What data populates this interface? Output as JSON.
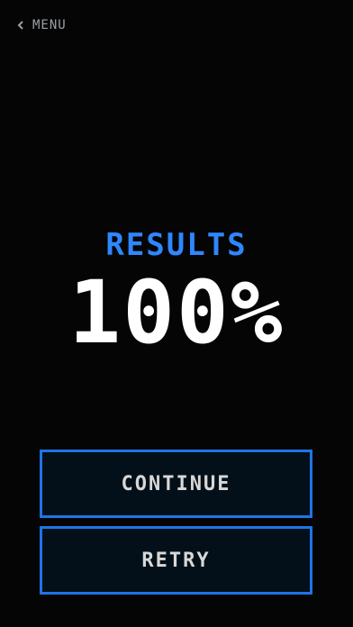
{
  "nav": {
    "back_label": "MENU",
    "back_icon": "chevron-left-icon"
  },
  "results": {
    "title": "RESULTS",
    "score": "100%",
    "score_value": 100
  },
  "buttons": {
    "continue_label": "CONTINUE",
    "retry_label": "RETRY"
  },
  "colors": {
    "background": "#050505",
    "accent": "#1f74e6",
    "title": "#2f87ff",
    "score_text": "#ffffff",
    "button_text": "#d8d8d8",
    "button_fill": "#041019",
    "nav_text": "#9aa0a6"
  }
}
